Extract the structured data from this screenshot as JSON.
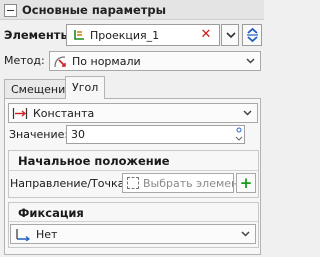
{
  "header": {
    "title": "Основные параметры"
  },
  "elements": {
    "label": "Элементы:",
    "value": "Проекция_1",
    "clear_symbol": "✕"
  },
  "method": {
    "label": "Метод:",
    "value": "По нормали"
  },
  "tabs": [
    {
      "label": "Смещение"
    },
    {
      "label": "Угол"
    }
  ],
  "angle": {
    "type_value": "Константа",
    "value_label": "Значение:",
    "value": "30",
    "start_position": {
      "title": "Начальное положение",
      "direction_label": "Направление/Точка:",
      "pick_placeholder": "Выбрать элемент",
      "add_symbol": "+"
    },
    "fixation": {
      "title": "Фиксация",
      "value": "Нет"
    }
  }
}
